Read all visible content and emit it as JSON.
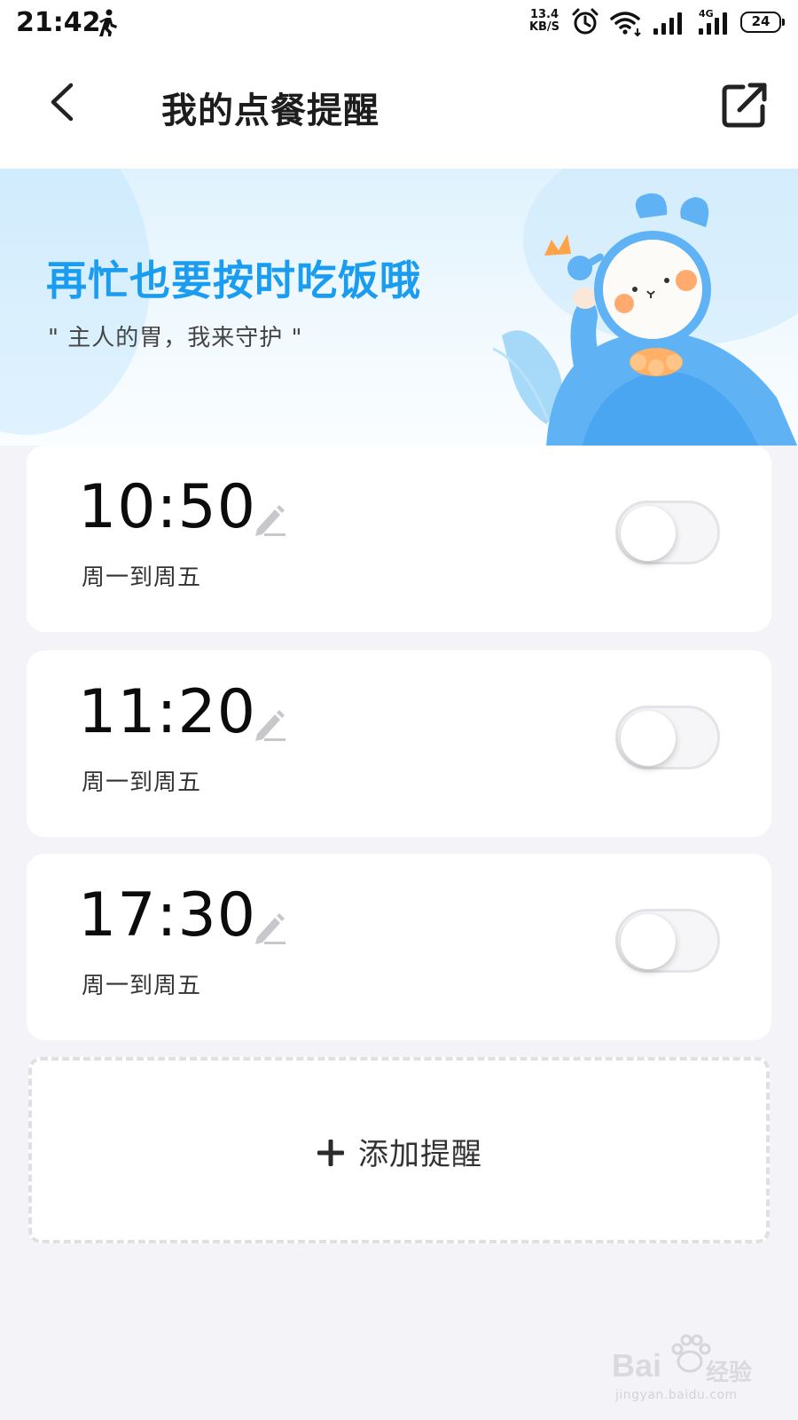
{
  "status_bar": {
    "time": "21:42",
    "net_speed_value": "13.4",
    "net_speed_unit": "KB/S",
    "network_type": "4G",
    "battery_level": "24",
    "icons": [
      "walk-icon",
      "alarm-icon",
      "wifi-icon",
      "signal-icon",
      "signal-4g-icon",
      "battery-icon"
    ]
  },
  "header": {
    "title": "我的点餐提醒",
    "back_icon": "chevron-left-icon",
    "share_icon": "share-external-icon"
  },
  "banner": {
    "title": "再忙也要按时吃饭哦",
    "subtitle": "\" 主人的胃，我来守护 \""
  },
  "reminders": [
    {
      "time": "10:50",
      "days": "周一到周五",
      "enabled": false
    },
    {
      "time": "11:20",
      "days": "周一到周五",
      "enabled": false
    },
    {
      "time": "17:30",
      "days": "周一到周五",
      "enabled": false
    }
  ],
  "add_button": {
    "label": "添加提醒",
    "icon": "plus-icon"
  },
  "watermark": {
    "brand": "Bai",
    "brand_cn": "经验",
    "url": "jingyan.baidu.com"
  },
  "colors": {
    "banner_title": "#1a9cf0",
    "page_background": "#f4f3f7",
    "card_background": "#ffffff",
    "toggle_off": "#f6f6f8"
  }
}
